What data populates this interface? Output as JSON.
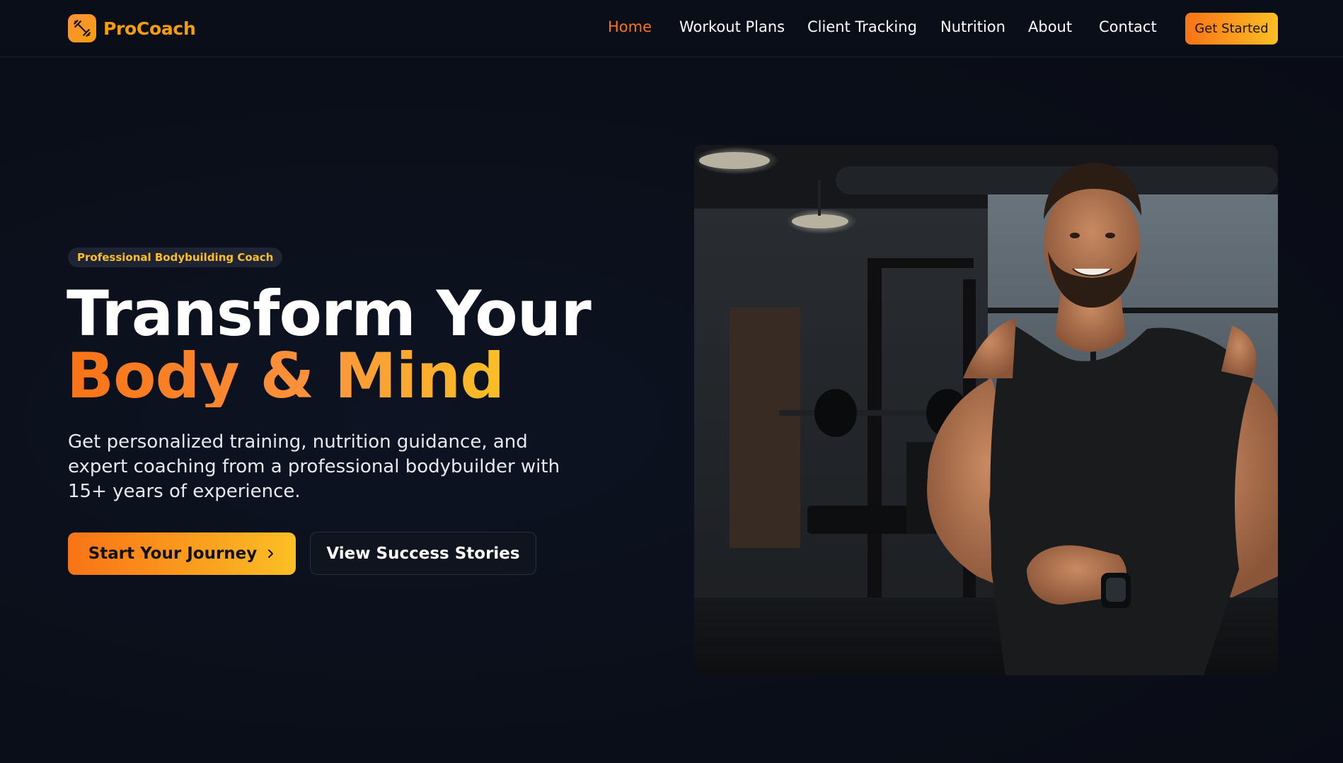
{
  "brand": {
    "name": "ProCoach",
    "logo_icon": "dumbbell-icon",
    "accent": "#f97316",
    "accent_light": "#fbbf24"
  },
  "nav": {
    "items": [
      {
        "label": "Home",
        "active": true
      },
      {
        "label": "Workout Plans"
      },
      {
        "label": "Client Tracking"
      },
      {
        "label": "Nutrition"
      },
      {
        "label": "About"
      },
      {
        "label": "Contact"
      }
    ],
    "cta_label": "Get Started"
  },
  "hero": {
    "badge": "Professional Bodybuilding Coach",
    "title_line1": "Transform Your",
    "title_line2": "Body & Mind",
    "description": "Get personalized training, nutrition guidance, and expert coaching from a professional bodybuilder with 15+ years of experience.",
    "primary_button": "Start Your Journey",
    "primary_icon": "chevron-right-icon",
    "secondary_button": "View Success Stories",
    "image": {
      "subject": "coach-portrait"
    }
  }
}
